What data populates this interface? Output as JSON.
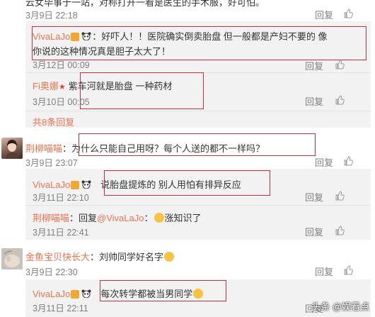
{
  "comments": {
    "top_partial": {
      "text": "云女毕事于一站，对称打开一看是医生的手术服，好可怕。",
      "time": "3月9日 22:18",
      "reply": "回复",
      "likes": "赞"
    },
    "c1_reply1": {
      "user": "VivaLaJo",
      "text_line1": "：好吓人！！医院确实倒卖胎盘 但一般都是产妇不要的 像",
      "text_line2": "你说的这种情况真是胆子太大了！",
      "time": "3月12日 00:09",
      "reply": "回复",
      "likes": "赞"
    },
    "c1_reply2": {
      "user": "Fi奥娜",
      "text": "紫车河就是胎盘 一种药材",
      "time": "3月10日 00:05",
      "reply": "回复",
      "likes": "赞"
    },
    "c1_more": "共8条回复",
    "c2": {
      "user": "荆柳喵喵",
      "text": "：为什么只能自己用呀？每个人送的都不一样吗？",
      "time": "3月9日 23:07",
      "reply": "回复",
      "likes": "赞"
    },
    "c2_reply1": {
      "user": "VivaLaJo",
      "text": "说胎盘提炼的 别人用怕有排异反应",
      "time": "3月11日 22:10",
      "reply": "回复",
      "likes": "赞"
    },
    "c2_reply2": {
      "user": "荆柳喵喵",
      "text_prefix": "：回复",
      "mention": "@VivaLaJo",
      "text_suffix": "：",
      "text_end": "涨知识了",
      "time": "3月11日 22:41",
      "reply": "回复",
      "likes": "赞"
    },
    "c3": {
      "user": "金鱼宝贝快长大",
      "text": "：刘帅同学好名字",
      "time": "3月9日 22:30",
      "reply": "回复",
      "likes": "赞"
    },
    "c3_reply1": {
      "user": "VivaLaJo",
      "text": "每次转学都被当男同学",
      "time": "3月11日 22:11",
      "reply": "回复",
      "likes": "赞"
    }
  },
  "watermark": "头条 @娱看点",
  "colors": {
    "username": "#eb7350",
    "highlight_box": "#c9303c",
    "reply_bg": "#f2f2f2"
  }
}
